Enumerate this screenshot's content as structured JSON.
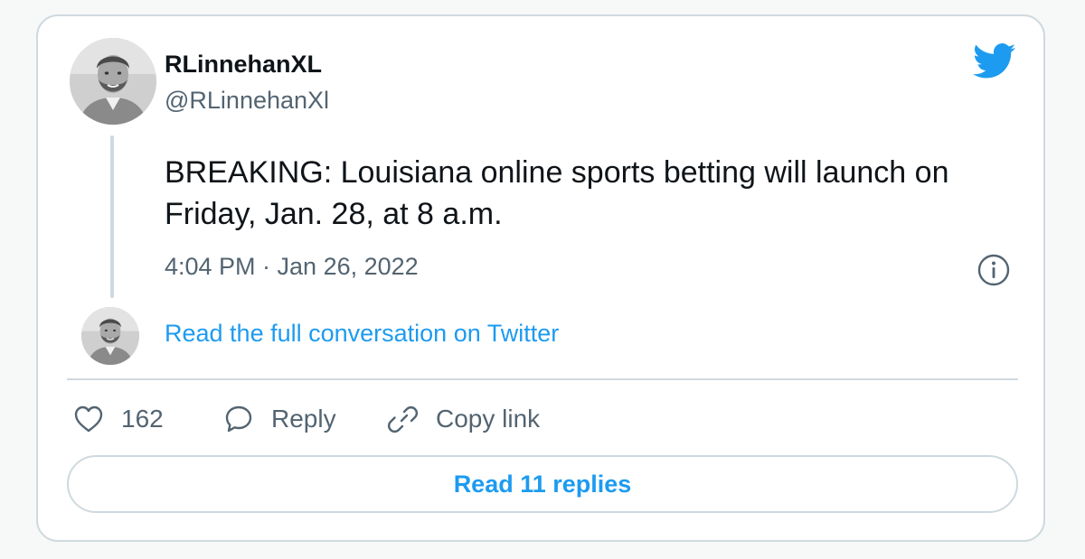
{
  "tweet": {
    "display_name": "RLinnehanXL",
    "handle": "@RLinnehanXl",
    "text": "BREAKING: Louisiana online sports betting will launch on Friday, Jan. 28, at 8 a.m.",
    "timestamp": "4:04 PM · Jan 26, 2022",
    "read_conversation": "Read the full conversation on Twitter"
  },
  "actions": {
    "likes_count": "162",
    "reply_label": "Reply",
    "copy_link_label": "Copy link"
  },
  "replies_button": "Read 11 replies",
  "icons": {
    "brand": "twitter-bird-icon",
    "info": "info-icon",
    "like": "heart-icon",
    "reply": "speech-bubble-icon",
    "copy": "link-icon"
  },
  "colors": {
    "accent": "#1d9bf0",
    "text": "#0f1419",
    "muted": "#536471",
    "border": "#cfd9de"
  }
}
